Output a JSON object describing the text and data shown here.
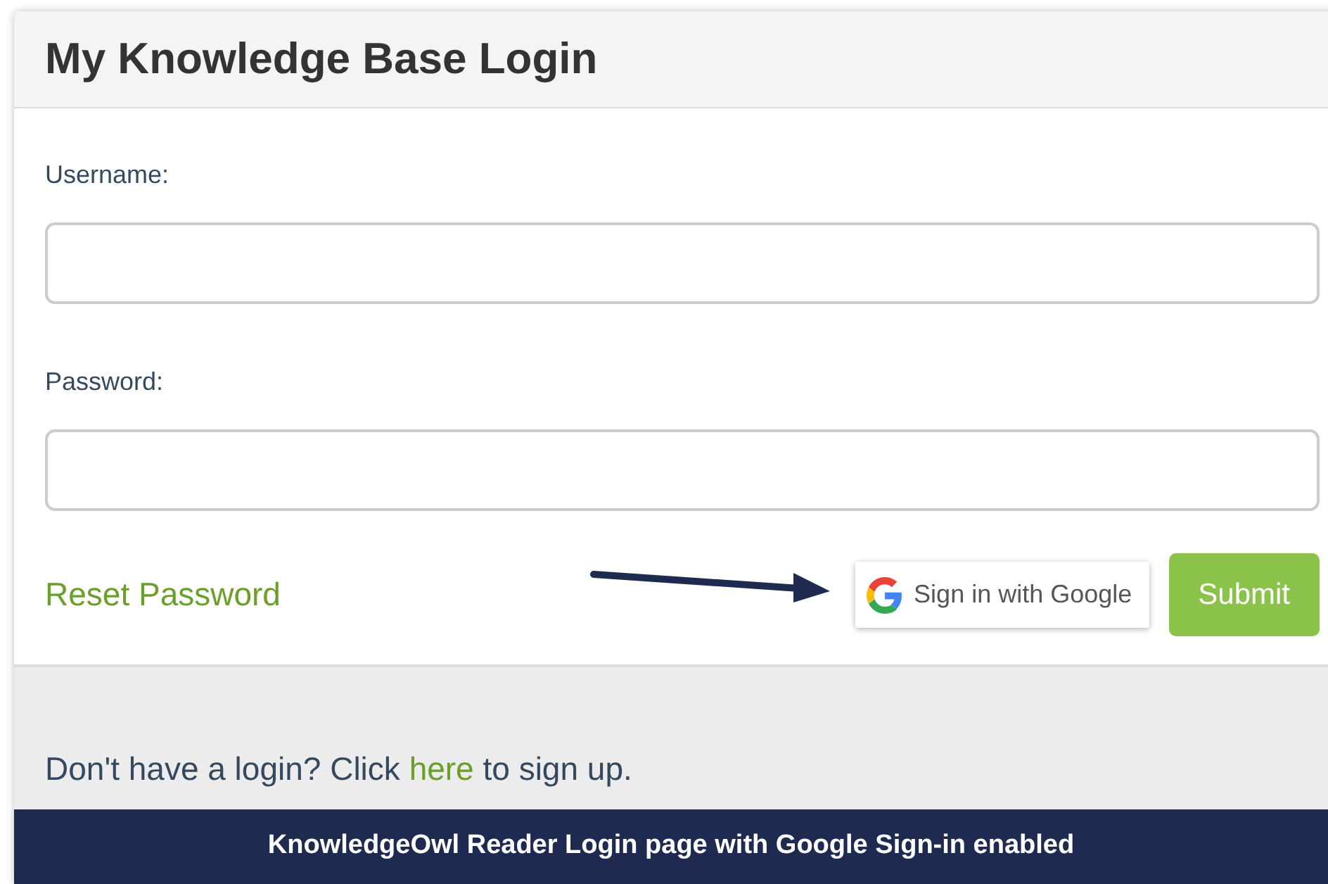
{
  "title": "My Knowledge Base Login",
  "fields": [
    {
      "label": "Username:"
    },
    {
      "label": "Password:"
    }
  ],
  "reset_link": "Reset Password",
  "google_button": "Sign in with Google",
  "submit_button": "Submit",
  "signup": {
    "before": "Don't have a login? Click ",
    "link": "here",
    "after": " to sign up."
  },
  "caption": "KnowledgeOwl Reader Login page with Google Sign-in enabled"
}
